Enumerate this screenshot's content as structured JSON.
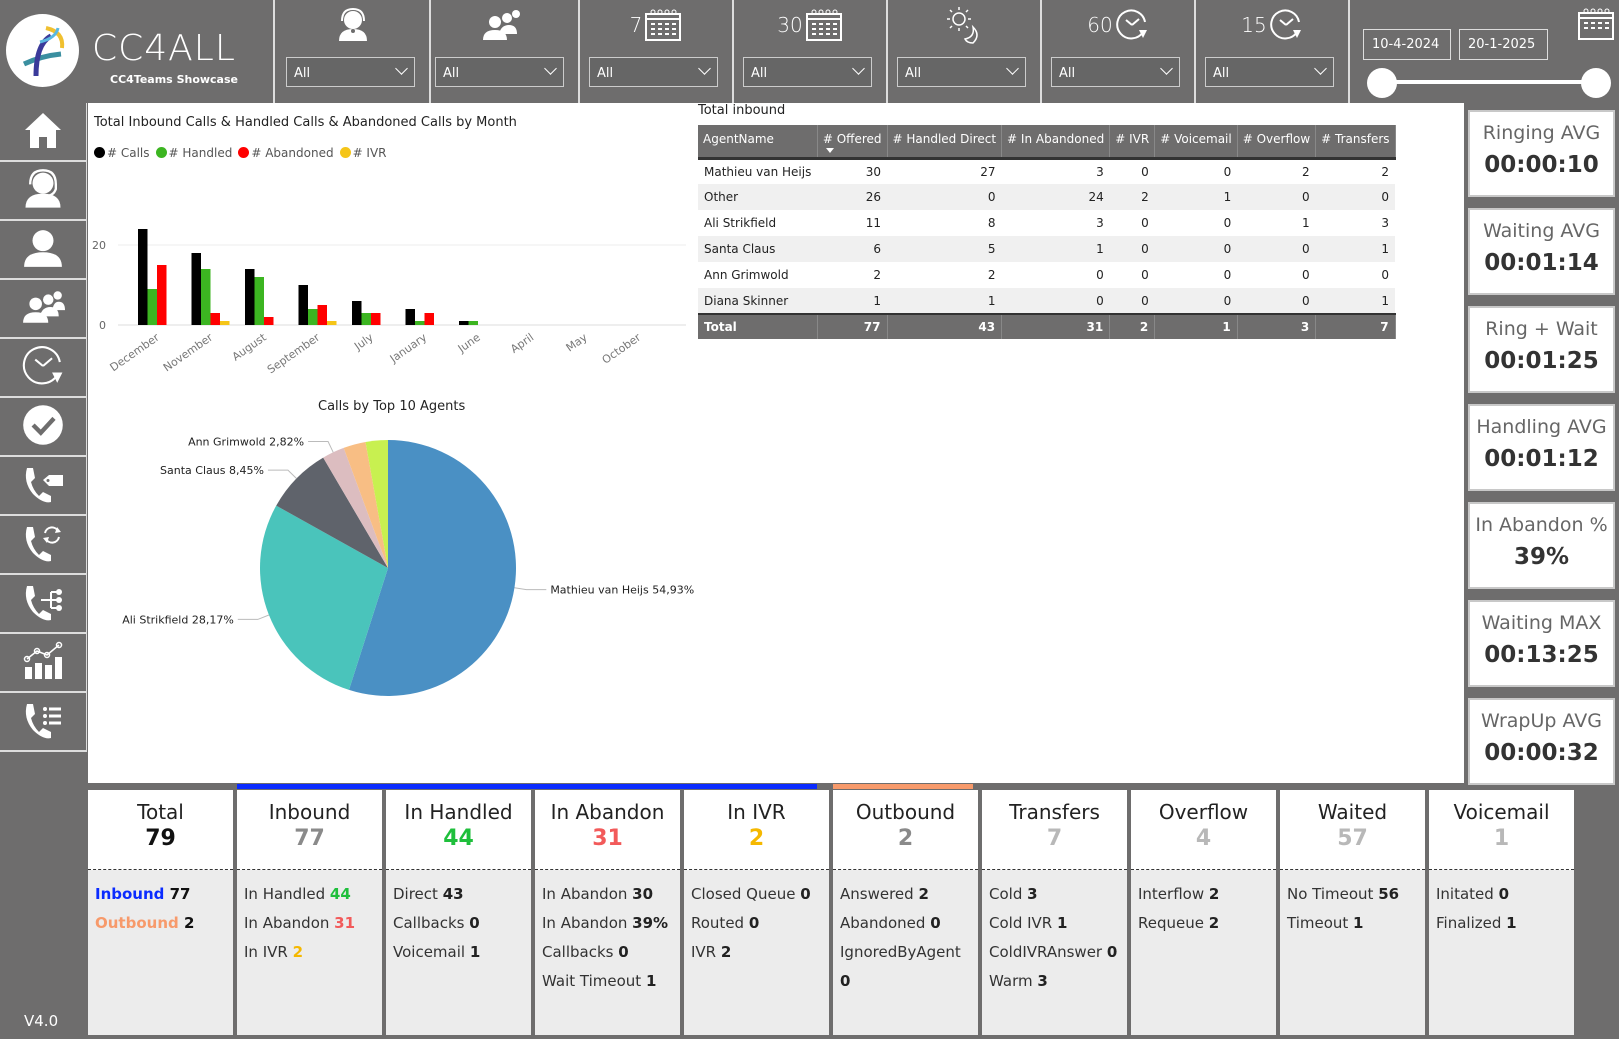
{
  "header": {
    "app_title": "CC4ALL",
    "subtitle": "CC4Teams Showcase",
    "filters": [
      {
        "icon": "agent-headset-icon",
        "prefix": "",
        "value": "All"
      },
      {
        "icon": "team-icon",
        "prefix": "",
        "value": "All"
      },
      {
        "icon": "calendar-icon",
        "prefix": "7",
        "value": "All"
      },
      {
        "icon": "calendar-icon",
        "prefix": "30",
        "value": "All"
      },
      {
        "icon": "day-night-icon",
        "prefix": "",
        "value": "All"
      },
      {
        "icon": "clock-icon",
        "prefix": "60",
        "value": "All"
      },
      {
        "icon": "clock-icon",
        "prefix": "15",
        "value": "All"
      }
    ],
    "date_start": "10-4-2024",
    "date_end": "20-1-2025",
    "date_range_fraction": [
      0,
      1
    ]
  },
  "sidebar": {
    "items": [
      {
        "icon": "home-icon"
      },
      {
        "icon": "agent-headset-icon"
      },
      {
        "icon": "user-icon"
      },
      {
        "icon": "team-icon"
      },
      {
        "icon": "clock-icon"
      },
      {
        "icon": "check-circle-icon"
      },
      {
        "icon": "phone-tag-icon"
      },
      {
        "icon": "phone-refresh-icon"
      },
      {
        "icon": "phone-tree-icon"
      },
      {
        "icon": "analytics-chart-icon"
      },
      {
        "icon": "phone-list-icon"
      }
    ],
    "version": "V4.0"
  },
  "chart_data": [
    {
      "type": "bar",
      "title": "Total Inbound Calls & Handled Calls & Abandoned Calls by Month",
      "categories": [
        "December",
        "November",
        "August",
        "September",
        "July",
        "January",
        "June",
        "April",
        "May",
        "October"
      ],
      "series": [
        {
          "name": "# Calls",
          "color": "#000000",
          "values": [
            24,
            18,
            14,
            10,
            6,
            4,
            1,
            0,
            0,
            0
          ]
        },
        {
          "name": "# Handled",
          "color": "#3cb521",
          "values": [
            9,
            14,
            12,
            4,
            3,
            1,
            1,
            0,
            0,
            0
          ]
        },
        {
          "name": "# Abandoned",
          "color": "#ff0000",
          "values": [
            15,
            3,
            2,
            5,
            3,
            3,
            0,
            0,
            0,
            0
          ]
        },
        {
          "name": "# IVR",
          "color": "#f5c518",
          "values": [
            0,
            1,
            0,
            1,
            0,
            0,
            0,
            0,
            0,
            0
          ]
        }
      ],
      "yticks": [
        0,
        20
      ],
      "ylim": [
        0,
        28
      ],
      "legend": "top-left",
      "grid": true
    },
    {
      "type": "pie",
      "title": "Calls by Top 10 Agents",
      "slices": [
        {
          "label": "Mathieu van Heijs",
          "value": 54.93,
          "display": "Mathieu van Heijs 54,93%",
          "color": "#4a90c4"
        },
        {
          "label": "Ali Strikfield",
          "value": 28.17,
          "display": "Ali Strikfield 28,17%",
          "color": "#4ac4bb"
        },
        {
          "label": "Santa Claus",
          "value": 8.45,
          "display": "Santa Claus 8,45%",
          "color": "#5f636b"
        },
        {
          "label": "Ann Grimwold",
          "value": 2.82,
          "display": "Ann Grimwold 2,82%",
          "color": "#dcbdc0"
        },
        {
          "label": "",
          "value": 2.82,
          "display": "",
          "color": "#f8be84"
        },
        {
          "label": "",
          "value": 2.81,
          "display": "",
          "color": "#c8f050"
        }
      ]
    }
  ],
  "table": {
    "title": "Total inbound",
    "columns": [
      "AgentName",
      "# Offered",
      "# Handled Direct",
      "# In Abandoned",
      "# IVR",
      "# Voicemail",
      "# Overflow",
      "# Transfers"
    ],
    "rows": [
      [
        "Mathieu van Heijs",
        "30",
        "27",
        "3",
        "0",
        "0",
        "2",
        "2"
      ],
      [
        "Other",
        "26",
        "0",
        "24",
        "2",
        "1",
        "0",
        "0"
      ],
      [
        "Ali Strikfield",
        "11",
        "8",
        "3",
        "0",
        "0",
        "1",
        "3"
      ],
      [
        "Santa Claus",
        "6",
        "5",
        "1",
        "0",
        "0",
        "0",
        "1"
      ],
      [
        "Ann Grimwold",
        "2",
        "2",
        "0",
        "0",
        "0",
        "0",
        "0"
      ],
      [
        "Diana Skinner",
        "1",
        "1",
        "0",
        "0",
        "0",
        "0",
        "1"
      ]
    ],
    "total": [
      "Total",
      "77",
      "43",
      "31",
      "2",
      "1",
      "3",
      "7"
    ]
  },
  "kpis": [
    {
      "label": "Ringing AVG",
      "value": "00:00:10"
    },
    {
      "label": "Waiting AVG",
      "value": "00:01:14"
    },
    {
      "label": "Ring + Wait",
      "value": "00:01:25"
    },
    {
      "label": "Handling AVG",
      "value": "00:01:12"
    },
    {
      "label": "In Abandon %",
      "value": "39%"
    },
    {
      "label": "Waiting MAX",
      "value": "00:13:25"
    },
    {
      "label": "WrapUp AVG",
      "value": "00:00:32"
    }
  ],
  "cards": [
    {
      "title": "Total",
      "value": "79",
      "value_color": "#111111",
      "lines": [
        {
          "label": "Inbound",
          "value": "77",
          "label_color": "#0a2bff",
          "label_bold": true,
          "value_color": "#111111"
        },
        {
          "label": "Outbound",
          "value": "2",
          "label_color": "#f79a6b",
          "label_bold": true,
          "value_color": "#111111"
        }
      ]
    },
    {
      "title": "Inbound",
      "value": "77",
      "value_color": "#8a8a8a",
      "lines": [
        {
          "label": "In Handled",
          "value": "44",
          "value_color": "#1fbf3c"
        },
        {
          "label": "In Abandon",
          "value": "31",
          "value_color": "#f25a5a"
        },
        {
          "label": "In IVR",
          "value": "2",
          "value_color": "#f5b800"
        }
      ]
    },
    {
      "title": "In Handled",
      "value": "44",
      "value_color": "#1fbf3c",
      "lines": [
        {
          "label": "Direct",
          "value": "43"
        },
        {
          "label": "Callbacks",
          "value": "0"
        },
        {
          "label": "Voicemail",
          "value": "1"
        }
      ]
    },
    {
      "title": "In Abandon",
      "value": "31",
      "value_color": "#f25a5a",
      "lines": [
        {
          "label": "In Abandon",
          "value": "30"
        },
        {
          "label": "In Abandon",
          "value": "39%"
        },
        {
          "label": "Callbacks",
          "value": "0"
        },
        {
          "label": "Wait Timeout",
          "value": "1"
        }
      ]
    },
    {
      "title": "In IVR",
      "value": "2",
      "value_color": "#f5b800",
      "lines": [
        {
          "label": "Closed Queue",
          "value": "0"
        },
        {
          "label": "Routed",
          "value": "0"
        },
        {
          "label": "IVR",
          "value": "2"
        }
      ]
    },
    {
      "title": "Outbound",
      "value": "2",
      "value_color": "#8a8a8a",
      "lines": [
        {
          "label": "Answered",
          "value": "2"
        },
        {
          "label": "Abandoned",
          "value": "0"
        },
        {
          "label": "IgnoredByAgent",
          "value": "0"
        }
      ]
    },
    {
      "title": "Transfers",
      "value": "7",
      "value_color": "#b8b8b8",
      "lines": [
        {
          "label": "Cold",
          "value": "3"
        },
        {
          "label": "Cold IVR",
          "value": "1"
        },
        {
          "label": "ColdIVRAnswer",
          "value": "0"
        },
        {
          "label": "Warm",
          "value": "3"
        }
      ]
    },
    {
      "title": "Overflow",
      "value": "4",
      "value_color": "#b8b8b8",
      "lines": [
        {
          "label": "Interflow",
          "value": "2"
        },
        {
          "label": "Requeue",
          "value": "2"
        }
      ]
    },
    {
      "title": "Waited",
      "value": "57",
      "value_color": "#b8b8b8",
      "lines": [
        {
          "label": "No Timeout",
          "value": "56"
        },
        {
          "label": "Timeout",
          "value": "1"
        }
      ]
    },
    {
      "title": "Voicemail",
      "value": "1",
      "value_color": "#b8b8b8",
      "lines": [
        {
          "label": "Initated",
          "value": "0"
        },
        {
          "label": "Finalized",
          "value": "1"
        }
      ]
    }
  ],
  "colors": {
    "inbound_accent": "#0a2bff",
    "outbound_accent": "#f79a6b",
    "panel_gray": "#6e6d6d"
  }
}
